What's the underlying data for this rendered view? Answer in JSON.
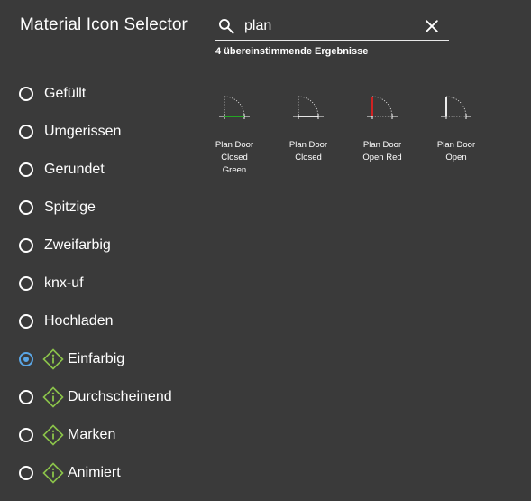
{
  "header": {
    "title": "Material Icon Selector"
  },
  "search": {
    "value": "plan",
    "search_icon": "search-icon",
    "clear_icon": "close-icon"
  },
  "results": {
    "count_text": "4 übereinstimmende Ergebnisse"
  },
  "icon_sets": [
    {
      "label": "Gefüllt",
      "selected": false,
      "badge": false
    },
    {
      "label": "Umgerissen",
      "selected": false,
      "badge": false
    },
    {
      "label": "Gerundet",
      "selected": false,
      "badge": false
    },
    {
      "label": "Spitzige",
      "selected": false,
      "badge": false
    },
    {
      "label": "Zweifarbig",
      "selected": false,
      "badge": false
    },
    {
      "label": "knx-uf",
      "selected": false,
      "badge": false
    },
    {
      "label": "Hochladen",
      "selected": false,
      "badge": false
    },
    {
      "label": "Einfarbig",
      "selected": true,
      "badge": true
    },
    {
      "label": "Durchscheinend",
      "selected": false,
      "badge": true
    },
    {
      "label": "Marken",
      "selected": false,
      "badge": true
    },
    {
      "label": "Animiert",
      "selected": false,
      "badge": true
    }
  ],
  "icons": [
    {
      "caption": [
        "Plan Door",
        "Closed",
        "Green"
      ],
      "icon": "plan-door-closed-green-icon",
      "accent": "#22b522"
    },
    {
      "caption": [
        "Plan Door",
        "Closed"
      ],
      "icon": "plan-door-closed-icon",
      "accent": "#ffffff"
    },
    {
      "caption": [
        "Plan Door",
        "Open Red"
      ],
      "icon": "plan-door-open-red-icon",
      "accent": "#e02020"
    },
    {
      "caption": [
        "Plan Door",
        "Open"
      ],
      "icon": "plan-door-open-icon",
      "accent": "#ffffff"
    }
  ],
  "colors": {
    "background": "#3a3a3a",
    "radio_selected": "#5aa6e6",
    "badge": "#8bc34a"
  }
}
